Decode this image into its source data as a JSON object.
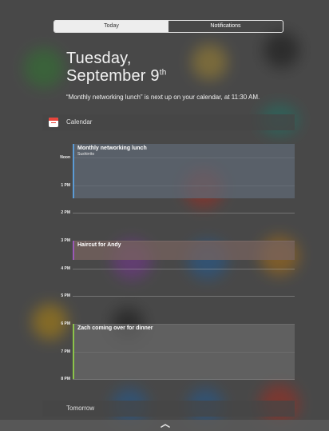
{
  "segmented_control": {
    "today_label": "Today",
    "notifications_label": "Notifications"
  },
  "date_header": {
    "weekday": "Tuesday,",
    "month_day": "September 9",
    "ordinal_suffix": "th"
  },
  "summary": {
    "text": "“Monthly networking lunch” is next up on your calendar, at 11:30 AM."
  },
  "calendar_section": {
    "title": "Calendar",
    "icon": "calendar-icon"
  },
  "timeline": {
    "hours": [
      "Noon",
      "1 PM",
      "2 PM",
      "3 PM",
      "4 PM",
      "5 PM",
      "6 PM",
      "7 PM",
      "8 PM"
    ],
    "events": [
      {
        "title": "Monthly networking lunch",
        "location": "Sushirrito",
        "color": "#5b9bd5"
      },
      {
        "title": "Haircut for Andy",
        "location": "",
        "color": "#9b59b6"
      },
      {
        "title": "Zach coming over for dinner",
        "location": "",
        "color": "#8bc34a"
      }
    ]
  },
  "tomorrow_section": {
    "title": "Tomorrow"
  },
  "colors": {
    "event_blue": "#5b9bd5",
    "event_purple": "#9b59b6",
    "event_green": "#8bc34a",
    "calendar_icon_red": "#e8453c"
  }
}
